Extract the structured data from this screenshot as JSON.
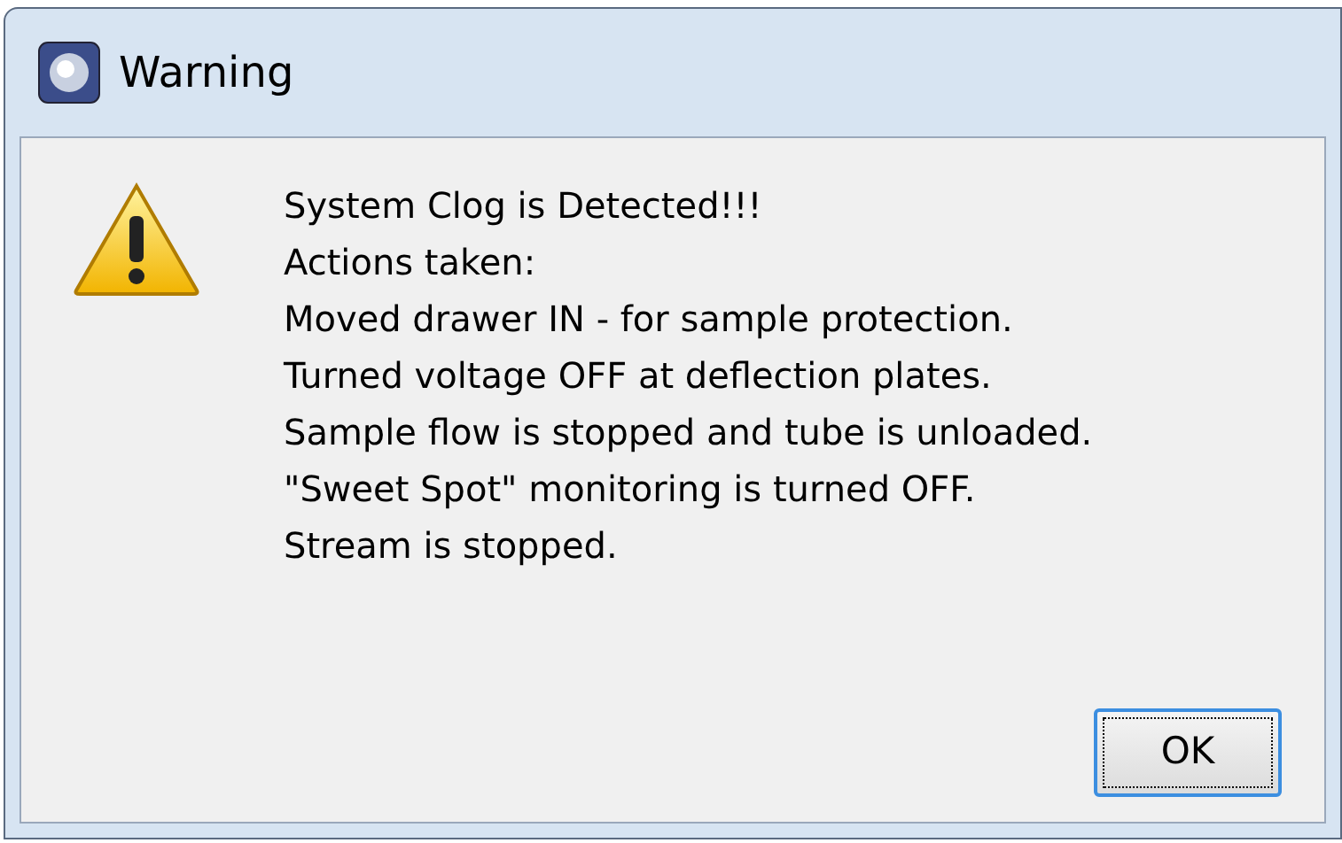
{
  "window": {
    "title": "Warning"
  },
  "message": {
    "lines": [
      "System Clog is Detected!!!",
      "Actions taken:",
      "Moved drawer IN - for sample protection.",
      "Turned voltage OFF at deflection plates.",
      "Sample flow is stopped and tube is unloaded.",
      "\"Sweet Spot\" monitoring is turned OFF.",
      "Stream is stopped."
    ]
  },
  "buttons": [
    {
      "label": "OK",
      "focused": true
    }
  ]
}
